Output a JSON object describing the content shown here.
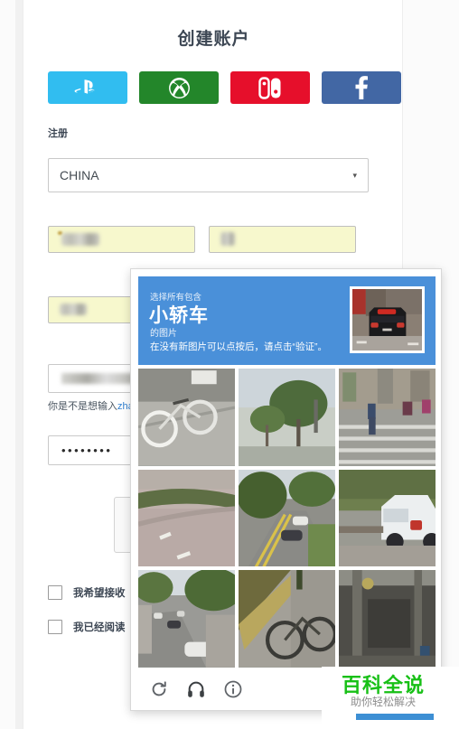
{
  "page": {
    "title": "创建账户"
  },
  "social_buttons": [
    {
      "name": "playstation",
      "label": "PlayStation",
      "color": "#31bdf0"
    },
    {
      "name": "xbox",
      "label": "Xbox",
      "color": "#23862a"
    },
    {
      "name": "nintendo-switch",
      "label": "Nintendo Switch",
      "color": "#e60f2b"
    },
    {
      "name": "facebook",
      "label": "Facebook",
      "color": "#4267a4"
    }
  ],
  "form": {
    "register_label": "注册",
    "country": {
      "value": "CHINA",
      "arrow": "▾"
    },
    "first_name": {
      "value": "",
      "autofilled": true
    },
    "last_name": {
      "value": "",
      "autofilled": true
    },
    "email": {
      "value": "",
      "autofilled": true
    },
    "username": {
      "value": ""
    },
    "username_hint_prefix": "你是不是想输入",
    "username_hint_link": "zha",
    "password": {
      "value": "••••••••"
    },
    "checkbox_newsletter": "我希望接收",
    "checkbox_terms": "我已经阅读",
    "submit_label": ""
  },
  "recaptcha": {
    "prefix": "选择所有包含",
    "target": "小轿车",
    "suffix": "的图片",
    "note": "在没有新图片可以点按后，请点击“验证”。",
    "header_color": "#4a90d9",
    "thumbnail_alt": "black car rear view",
    "tiles": [
      {
        "id": 1,
        "scene": "bicycle-on-pavement"
      },
      {
        "id": 2,
        "scene": "trees-and-sky"
      },
      {
        "id": 3,
        "scene": "crosswalk-pedestrians"
      },
      {
        "id": 4,
        "scene": "empty-road-hedge"
      },
      {
        "id": 5,
        "scene": "road-with-cars"
      },
      {
        "id": 6,
        "scene": "white-suv-parked"
      },
      {
        "id": 7,
        "scene": "street-with-cars"
      },
      {
        "id": 8,
        "scene": "bicycle-on-slope"
      },
      {
        "id": 9,
        "scene": "dark-pole-street"
      }
    ],
    "footer_icons": [
      {
        "name": "reload-icon",
        "glyph": "⟳"
      },
      {
        "name": "audio-icon",
        "glyph": "🎧"
      },
      {
        "name": "info-icon",
        "glyph": "ⓘ"
      }
    ]
  },
  "watermark": {
    "title": "百科全说",
    "subtitle": "助你轻松解决",
    "title_color": "#18c017",
    "bar_color": "#3d8fd4"
  }
}
